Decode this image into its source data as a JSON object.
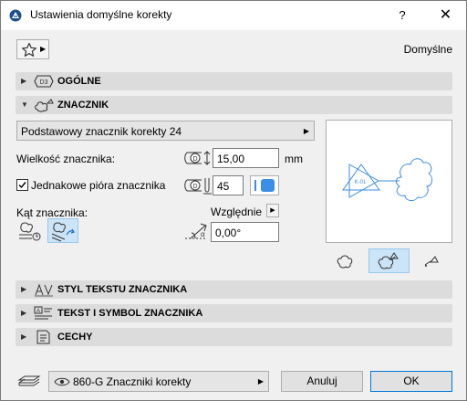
{
  "window": {
    "title": "Ustawienia domyślne korekty",
    "help": "?",
    "close": "✕"
  },
  "header": {
    "preset_label": "Domyślne"
  },
  "sections": {
    "general": "OGÓLNE",
    "marker": "ZNACZNIK",
    "marker_text_style": "STYL TEKSTU ZNACZNIKA",
    "marker_text_symbol": "TEKST I SYMBOL ZNACZNIKA",
    "properties": "CECHY"
  },
  "marker": {
    "type_select": "Podstawowy znacznik korekty 24",
    "size_label": "Wielkość znacznika:",
    "size_value": "15,00",
    "size_unit": "mm",
    "equal_pens_label": "Jednakowe pióra znacznika",
    "equal_pens_checked": true,
    "pen_value": "45",
    "pen_color": "#3a8ee6",
    "angle_label": "Kąt znacznika:",
    "relative_label": "Względnie",
    "angle_value": "0,00°",
    "preview_text": "K-01",
    "preview_color": "#3a8ee6"
  },
  "footer": {
    "layer": "860-G Znaczniki korekty",
    "cancel": "Anuluj",
    "ok": "OK"
  }
}
